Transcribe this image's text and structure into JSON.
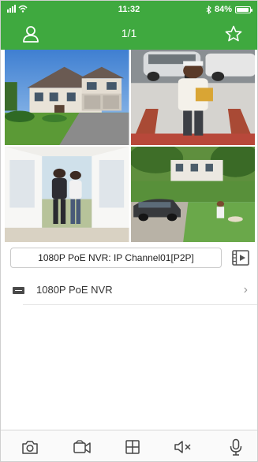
{
  "status_bar": {
    "time": "11:32",
    "battery_text": "84%",
    "battery_level": 0.84
  },
  "header": {
    "page_indicator": "1/1",
    "left_icon": "user-icon",
    "right_icon": "star-icon"
  },
  "cameras": [
    {
      "name": "house-exterior"
    },
    {
      "name": "visitor-at-door"
    },
    {
      "name": "couple-at-entrance"
    },
    {
      "name": "driveway-with-car"
    }
  ],
  "channel": {
    "label": "1080P PoE NVR: IP Channel01[P2P]",
    "button_icon": "video-playback-icon"
  },
  "devices": [
    {
      "name": "1080P PoE NVR",
      "icon": "dvr-icon"
    }
  ],
  "toolbar": {
    "icons": [
      "camera-icon",
      "record-icon",
      "grid-icon",
      "mute-icon",
      "microphone-icon"
    ]
  },
  "colors": {
    "brand_green": "#3fa93f"
  }
}
